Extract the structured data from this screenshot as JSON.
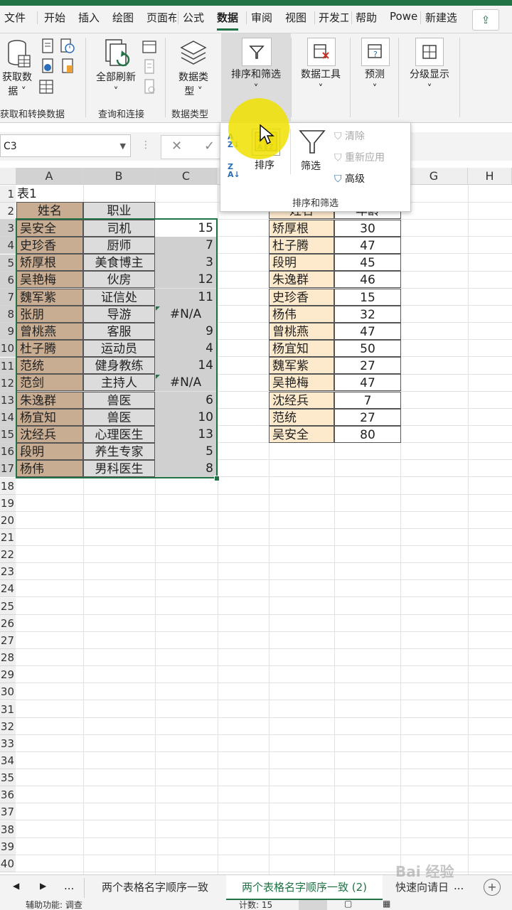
{
  "ribbon_tabs": [
    "文件",
    "开始",
    "插入",
    "绘图",
    "页面布",
    "公式",
    "数据",
    "审阅",
    "视图",
    "开发工",
    "帮助",
    "Powe",
    "新建选"
  ],
  "active_tab": "数据",
  "groups": {
    "get_transform": {
      "btn": "获取数\n据",
      "label": "获取和转换数据"
    },
    "queries": {
      "btn": "全部刷新",
      "label": "查询和连接"
    },
    "data_types": {
      "btn": "数据类\n型",
      "label": "数据类型"
    },
    "sort_filter": {
      "btn": "排序和筛选"
    },
    "data_tools": {
      "btn": "数据工具"
    },
    "forecast": {
      "btn": "预测"
    },
    "outline": {
      "btn": "分级显示"
    }
  },
  "popup": {
    "sort_label": "排序",
    "filter_label": "筛选",
    "clear_label": "清除",
    "reapply_label": "重新应用",
    "advanced_label": "高级",
    "group_label": "排序和筛选"
  },
  "namebox": "C3",
  "columns": [
    "A",
    "B",
    "C",
    "",
    "",
    "F",
    "G",
    "H"
  ],
  "rows": [
    "1",
    "2",
    "3",
    "4",
    "5",
    "6",
    "7",
    "8",
    "9",
    "10",
    "11",
    "12",
    "13",
    "14",
    "15",
    "16",
    "17",
    "18",
    "19",
    "20",
    "21",
    "22",
    "23",
    "24",
    "25",
    "26",
    "27",
    "28",
    "29",
    "30",
    "31",
    "32",
    "33",
    "34",
    "35",
    "36",
    "37",
    "38",
    "39",
    "40"
  ],
  "table1": {
    "title": "表1",
    "headers": [
      "姓名",
      "职业"
    ],
    "rows": [
      [
        "吴安全",
        "司机",
        "15"
      ],
      [
        "史珍香",
        "厨师",
        "7"
      ],
      [
        "矫厚根",
        "美食博主",
        "3"
      ],
      [
        "吴艳梅",
        "伙房",
        "12"
      ],
      [
        "魏军紫",
        "证信处",
        "11"
      ],
      [
        "张朋",
        "导游",
        "#N/A"
      ],
      [
        "曾桃燕",
        "客服",
        "9"
      ],
      [
        "杜子腾",
        "运动员",
        "4"
      ],
      [
        "范统",
        "健身教练",
        "14"
      ],
      [
        "范剑",
        "主持人",
        "#N/A"
      ],
      [
        "朱逸群",
        "兽医",
        "6"
      ],
      [
        "杨宜知",
        "兽医",
        "10"
      ],
      [
        "沈经兵",
        "心理医生",
        "13"
      ],
      [
        "段明",
        "养生专家",
        "5"
      ],
      [
        "杨伟",
        "男科医生",
        "8"
      ]
    ]
  },
  "table2": {
    "headers": [
      "姓名",
      "年龄"
    ],
    "rows": [
      [
        "矫厚根",
        "30"
      ],
      [
        "杜子腾",
        "47"
      ],
      [
        "段明",
        "45"
      ],
      [
        "朱逸群",
        "46"
      ],
      [
        "史珍香",
        "15"
      ],
      [
        "杨伟",
        "32"
      ],
      [
        "曾桃燕",
        "47"
      ],
      [
        "杨宜知",
        "50"
      ],
      [
        "魏军紫",
        "27"
      ],
      [
        "吴艳梅",
        "47"
      ],
      [
        "沈经兵",
        "7"
      ],
      [
        "范统",
        "27"
      ],
      [
        "吴安全",
        "80"
      ]
    ]
  },
  "sheet_tabs": [
    "两个表格名字顺序一致",
    "两个表格名字顺序一致 (2)",
    "快速向请日"
  ],
  "active_sheet": "两个表格名字顺序一致 (2)",
  "ellipsis": "...",
  "status": {
    "accessibility": "辅助功能: 调查",
    "count": "计数: 15"
  },
  "watermark": "Bai 经验",
  "colors": {
    "accent": "#217346",
    "name_fill": "#c8ad92",
    "occupation_fill": "#dcdcdc",
    "popup_name_fill": "#fde9cc"
  }
}
